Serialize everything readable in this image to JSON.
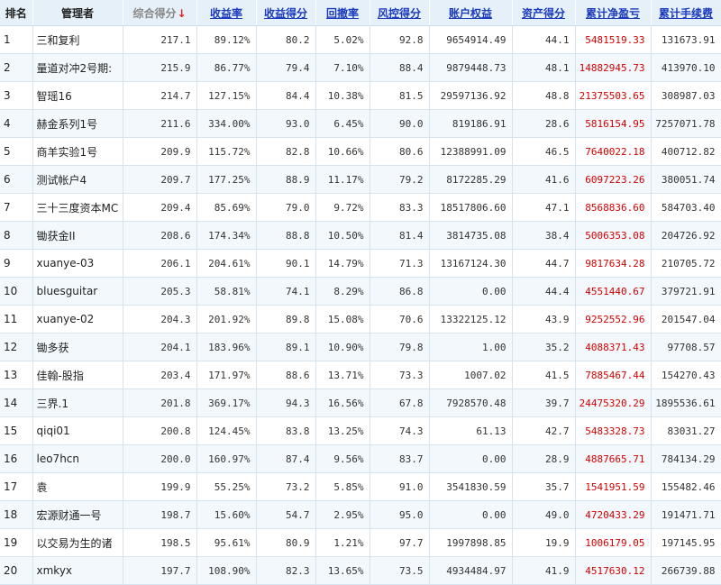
{
  "headers": {
    "rank": "排名",
    "manager": "管理者",
    "composite": "综合得分",
    "sort_arrow": "↓",
    "return_rate": "收益率",
    "return_score": "收益得分",
    "drawdown": "回撤率",
    "risk_score": "风控得分",
    "equity": "账户权益",
    "asset_score": "资产得分",
    "cum_pnl": "累计净盈亏",
    "cum_fee": "累计手续费"
  },
  "colors": {
    "header_bg": "#e6f0f9",
    "link": "#1a3bbd",
    "profit": "#d40000",
    "sort_arrow": "#e02020"
  },
  "rows": [
    {
      "rank": "1",
      "name": "三和复利",
      "composite": "217.1",
      "ret": "89.12%",
      "ret_score": "80.2",
      "dd": "5.02%",
      "risk": "92.8",
      "equity": "9654914.49",
      "asset": "44.1",
      "pnl": "5481519.33",
      "fee": "131673.91"
    },
    {
      "rank": "2",
      "name": "量道对冲2号期:",
      "composite": "215.9",
      "ret": "86.77%",
      "ret_score": "79.4",
      "dd": "7.10%",
      "risk": "88.4",
      "equity": "9879448.73",
      "asset": "48.1",
      "pnl": "14882945.73",
      "fee": "413970.10"
    },
    {
      "rank": "3",
      "name": "智瑶16",
      "composite": "214.7",
      "ret": "127.15%",
      "ret_score": "84.4",
      "dd": "10.38%",
      "risk": "81.5",
      "equity": "29597136.92",
      "asset": "48.8",
      "pnl": "21375503.65",
      "fee": "308987.03"
    },
    {
      "rank": "4",
      "name": "赫金系列1号",
      "composite": "211.6",
      "ret": "334.00%",
      "ret_score": "93.0",
      "dd": "6.45%",
      "risk": "90.0",
      "equity": "819186.91",
      "asset": "28.6",
      "pnl": "5816154.95",
      "fee": "7257071.78"
    },
    {
      "rank": "5",
      "name": "商羊实验1号",
      "composite": "209.9",
      "ret": "115.72%",
      "ret_score": "82.8",
      "dd": "10.66%",
      "risk": "80.6",
      "equity": "12388991.09",
      "asset": "46.5",
      "pnl": "7640022.18",
      "fee": "400712.82"
    },
    {
      "rank": "6",
      "name": "测试帐户4",
      "composite": "209.7",
      "ret": "177.25%",
      "ret_score": "88.9",
      "dd": "11.17%",
      "risk": "79.2",
      "equity": "8172285.29",
      "asset": "41.6",
      "pnl": "6097223.26",
      "fee": "380051.74"
    },
    {
      "rank": "7",
      "name": "三十三度资本MC",
      "composite": "209.4",
      "ret": "85.69%",
      "ret_score": "79.0",
      "dd": "9.72%",
      "risk": "83.3",
      "equity": "18517806.60",
      "asset": "47.1",
      "pnl": "8568836.60",
      "fee": "584703.40"
    },
    {
      "rank": "8",
      "name": "锄获金II",
      "composite": "208.6",
      "ret": "174.34%",
      "ret_score": "88.8",
      "dd": "10.50%",
      "risk": "81.4",
      "equity": "3814735.08",
      "asset": "38.4",
      "pnl": "5006353.08",
      "fee": "204726.92"
    },
    {
      "rank": "9",
      "name": "xuanye-03",
      "composite": "206.1",
      "ret": "204.61%",
      "ret_score": "90.1",
      "dd": "14.79%",
      "risk": "71.3",
      "equity": "13167124.30",
      "asset": "44.7",
      "pnl": "9817634.28",
      "fee": "210705.72"
    },
    {
      "rank": "10",
      "name": "bluesguitar",
      "composite": "205.3",
      "ret": "58.81%",
      "ret_score": "74.1",
      "dd": "8.29%",
      "risk": "86.8",
      "equity": "0.00",
      "asset": "44.4",
      "pnl": "4551440.67",
      "fee": "379721.91"
    },
    {
      "rank": "11",
      "name": "xuanye-02",
      "composite": "204.3",
      "ret": "201.92%",
      "ret_score": "89.8",
      "dd": "15.08%",
      "risk": "70.6",
      "equity": "13322125.12",
      "asset": "43.9",
      "pnl": "9252552.96",
      "fee": "201547.04"
    },
    {
      "rank": "12",
      "name": "锄多获",
      "composite": "204.1",
      "ret": "183.96%",
      "ret_score": "89.1",
      "dd": "10.90%",
      "risk": "79.8",
      "equity": "1.00",
      "asset": "35.2",
      "pnl": "4088371.43",
      "fee": "97708.57"
    },
    {
      "rank": "13",
      "name": "佳翰-股指",
      "composite": "203.4",
      "ret": "171.97%",
      "ret_score": "88.6",
      "dd": "13.71%",
      "risk": "73.3",
      "equity": "1007.02",
      "asset": "41.5",
      "pnl": "7885467.44",
      "fee": "154270.43"
    },
    {
      "rank": "14",
      "name": "三界.1",
      "composite": "201.8",
      "ret": "369.17%",
      "ret_score": "94.3",
      "dd": "16.56%",
      "risk": "67.8",
      "equity": "7928570.48",
      "asset": "39.7",
      "pnl": "24475320.29",
      "fee": "1895536.61"
    },
    {
      "rank": "15",
      "name": "qiqi01",
      "composite": "200.8",
      "ret": "124.45%",
      "ret_score": "83.8",
      "dd": "13.25%",
      "risk": "74.3",
      "equity": "61.13",
      "asset": "42.7",
      "pnl": "5483328.73",
      "fee": "83031.27"
    },
    {
      "rank": "16",
      "name": "leo7hcn",
      "composite": "200.0",
      "ret": "160.97%",
      "ret_score": "87.4",
      "dd": "9.56%",
      "risk": "83.7",
      "equity": "0.00",
      "asset": "28.9",
      "pnl": "4887665.71",
      "fee": "784134.29"
    },
    {
      "rank": "17",
      "name": "袁",
      "composite": "199.9",
      "ret": "55.25%",
      "ret_score": "73.2",
      "dd": "5.85%",
      "risk": "91.0",
      "equity": "3541830.59",
      "asset": "35.7",
      "pnl": "1541951.59",
      "fee": "155482.46"
    },
    {
      "rank": "18",
      "name": "宏源财通一号",
      "composite": "198.7",
      "ret": "15.60%",
      "ret_score": "54.7",
      "dd": "2.95%",
      "risk": "95.0",
      "equity": "0.00",
      "asset": "49.0",
      "pnl": "4720433.29",
      "fee": "191471.71"
    },
    {
      "rank": "19",
      "name": "以交易为生的诸",
      "composite": "198.5",
      "ret": "95.61%",
      "ret_score": "80.9",
      "dd": "1.21%",
      "risk": "97.7",
      "equity": "1997898.85",
      "asset": "19.9",
      "pnl": "1006179.05",
      "fee": "197145.95"
    },
    {
      "rank": "20",
      "name": "xmkyx",
      "composite": "197.7",
      "ret": "108.90%",
      "ret_score": "82.3",
      "dd": "13.65%",
      "risk": "73.5",
      "equity": "4934484.97",
      "asset": "41.9",
      "pnl": "4517630.12",
      "fee": "266739.88"
    }
  ]
}
